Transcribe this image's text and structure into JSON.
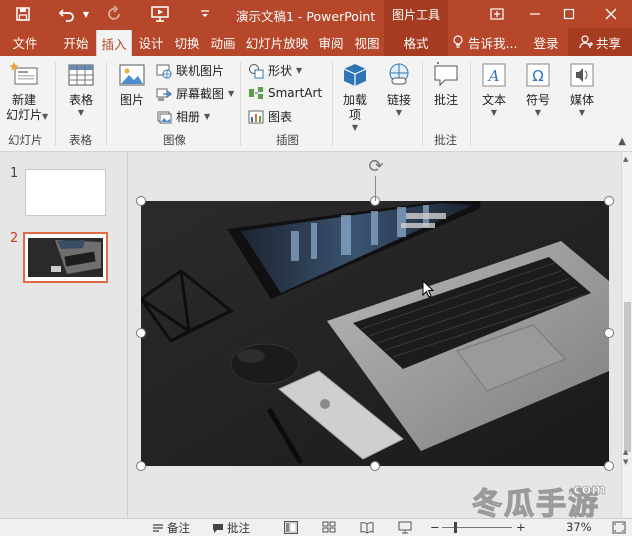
{
  "window": {
    "doc_title": "演示文稿1 - PowerPoint",
    "context_tab": "图片工具"
  },
  "tabs": [
    {
      "label": "文件"
    },
    {
      "label": "开始"
    },
    {
      "label": "插入"
    },
    {
      "label": "设计"
    },
    {
      "label": "切换"
    },
    {
      "label": "动画"
    },
    {
      "label": "幻灯片放映"
    },
    {
      "label": "审阅"
    },
    {
      "label": "视图"
    },
    {
      "label": "格式"
    }
  ],
  "active_tab": "插入",
  "tell_me": "告诉我...",
  "login": "登录",
  "share": "共享",
  "ribbon": {
    "new_slide": "新建\n幻灯片",
    "table": "表格",
    "picture": "图片",
    "online_pictures": "联机图片",
    "screenshot": "屏幕截图",
    "album": "相册",
    "shapes": "形状",
    "smartart": "SmartArt",
    "chart": "图表",
    "addins": "加载\n项",
    "links": "链接",
    "comment": "批注",
    "text": "文本",
    "symbols": "符号",
    "media": "媒体",
    "groups": {
      "slides": "幻灯片",
      "tables": "表格",
      "images": "图像",
      "illustrations": "插图",
      "comments": "批注"
    }
  },
  "slides": [
    {
      "number": "1"
    },
    {
      "number": "2"
    }
  ],
  "statusbar": {
    "notes": "备注",
    "comments": "批注",
    "zoom": "37%"
  },
  "watermark": {
    "text": "冬瓜手游",
    "suffix": ".com"
  },
  "colors": {
    "accent": "#b7472a",
    "accent_dark": "#a53c22",
    "ribbon_bg": "#f3f3f3"
  }
}
